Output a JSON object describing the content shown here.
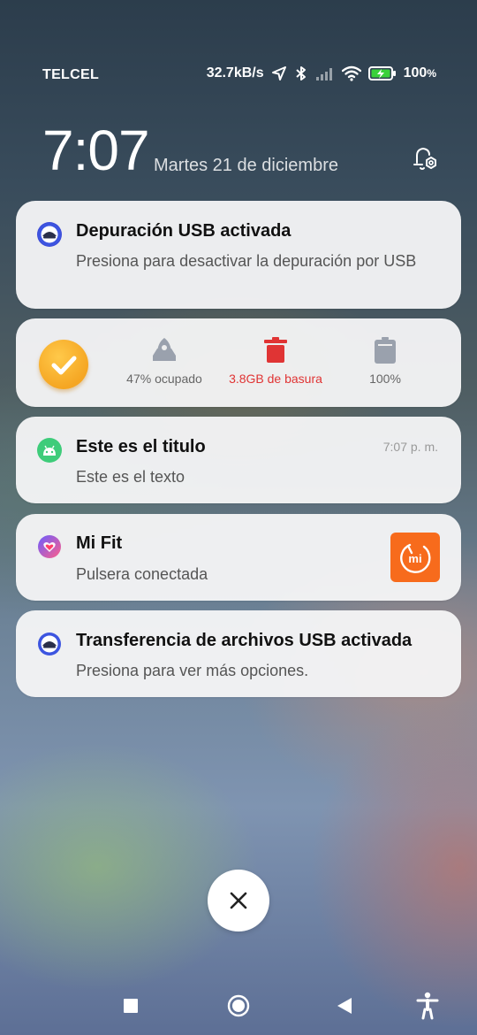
{
  "status_bar": {
    "carrier": "TELCEL",
    "net_speed": "32.7kB/s",
    "battery_level": "100",
    "battery_unit": "%"
  },
  "lockscreen": {
    "time": "7:07",
    "date": "Martes 21 de diciembre"
  },
  "notifications": [
    {
      "app_icon": "usb-debug-icon",
      "title": "Depuración USB activada",
      "text": "Presiona para desactivar la depuración por USB"
    },
    {
      "type": "cleaner",
      "storage_label": "47% ocupado",
      "junk_label": "3.8GB de basura",
      "battery_label": "100%",
      "colors": {
        "junk": "#e03434",
        "check": "#f5a623"
      }
    },
    {
      "app_icon": "android-icon",
      "title": "Este es el titulo",
      "text": "Este es el texto",
      "time": "7:07 p. m."
    },
    {
      "app_icon": "mi-fit-icon",
      "title": "Mi Fit",
      "text": "Pulsera conectada",
      "thumbnail_text": "mi",
      "thumbnail_color": "#f76b1c"
    },
    {
      "app_icon": "usb-transfer-icon",
      "title": "Transferencia de archivos USB activada",
      "text": "Presiona para ver más opciones."
    }
  ],
  "nav_icons": [
    "recents-square-icon",
    "home-circle-icon",
    "back-triangle-icon",
    "accessibility-icon"
  ]
}
